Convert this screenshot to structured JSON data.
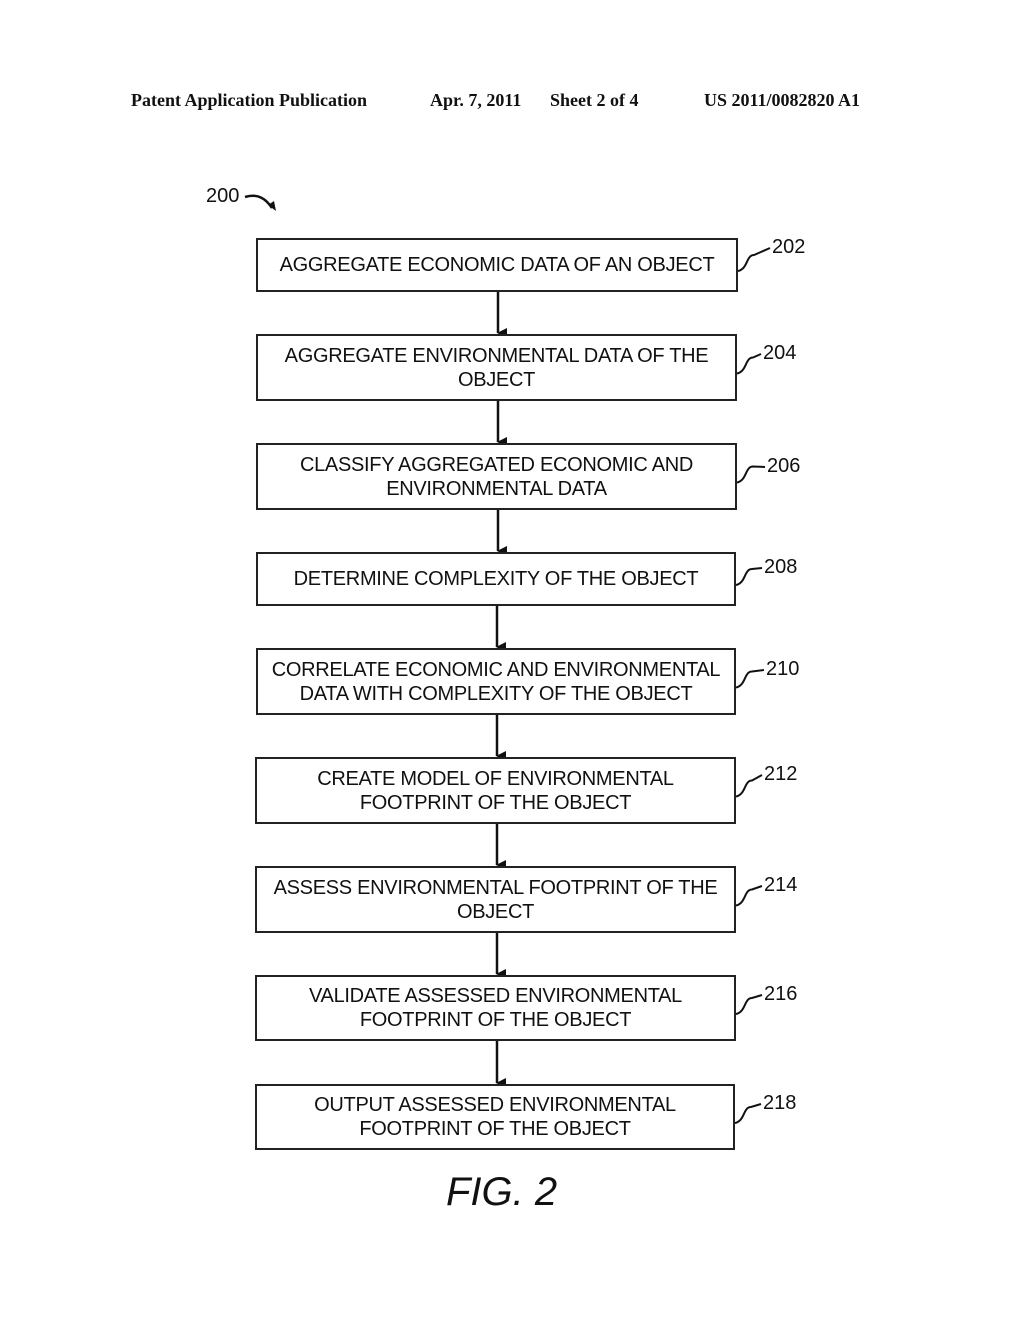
{
  "header": {
    "publication": "Patent Application Publication",
    "date": "Apr. 7, 2011",
    "sheet": "Sheet 2 of 4",
    "number": "US 2011/0082820 A1"
  },
  "diagram": {
    "ref": "200",
    "steps": [
      {
        "ref": "202",
        "text": "AGGREGATE ECONOMIC DATA OF AN OBJECT"
      },
      {
        "ref": "204",
        "text": "AGGREGATE ENVIRONMENTAL DATA OF THE\nOBJECT"
      },
      {
        "ref": "206",
        "text": "CLASSIFY AGGREGATED ECONOMIC AND\nENVIRONMENTAL DATA"
      },
      {
        "ref": "208",
        "text": "DETERMINE COMPLEXITY OF THE OBJECT"
      },
      {
        "ref": "210",
        "text": "CORRELATE ECONOMIC AND ENVIRONMENTAL\nDATA WITH COMPLEXITY OF THE OBJECT"
      },
      {
        "ref": "212",
        "text": "CREATE MODEL OF ENVIRONMENTAL\nFOOTPRINT OF THE OBJECT"
      },
      {
        "ref": "214",
        "text": "ASSESS ENVIRONMENTAL FOOTPRINT OF THE\nOBJECT"
      },
      {
        "ref": "216",
        "text": "VALIDATE ASSESSED ENVIRONMENTAL\nFOOTPRINT OF THE OBJECT"
      },
      {
        "ref": "218",
        "text": "OUTPUT ASSESSED ENVIRONMENTAL\nFOOTPRINT OF THE OBJECT"
      }
    ],
    "figure_label": "FIG. 2"
  }
}
